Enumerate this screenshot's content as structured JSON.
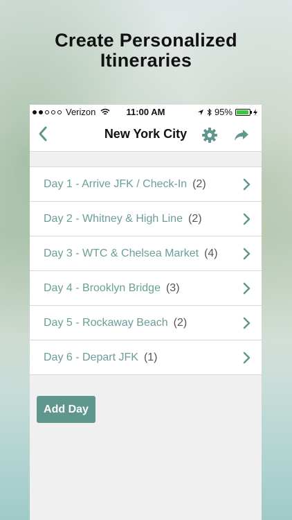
{
  "headline": {
    "line1": "Create Personalized",
    "line2": "Itineraries"
  },
  "status_bar": {
    "carrier": "Verizon",
    "time": "11:00 AM",
    "battery": "95%"
  },
  "nav": {
    "title": "New York City",
    "icons": [
      "back-chevron-icon",
      "gear-icon",
      "share-icon"
    ]
  },
  "days": [
    {
      "label": "Day 1 - Arrive JFK / Check-In",
      "count": "(2)"
    },
    {
      "label": "Day 2 - Whitney & High Line",
      "count": "(2)"
    },
    {
      "label": "Day 3 - WTC & Chelsea Market",
      "count": "(4)"
    },
    {
      "label": "Day 4 - Brooklyn Bridge",
      "count": "(3)"
    },
    {
      "label": "Day 5 - Rockaway Beach",
      "count": "(2)"
    },
    {
      "label": "Day 6 - Depart JFK",
      "count": "(1)"
    }
  ],
  "add_day_label": "Add Day",
  "colors": {
    "accent": "#6a9e98",
    "button": "#5f978f",
    "battery": "#3ec53e"
  }
}
